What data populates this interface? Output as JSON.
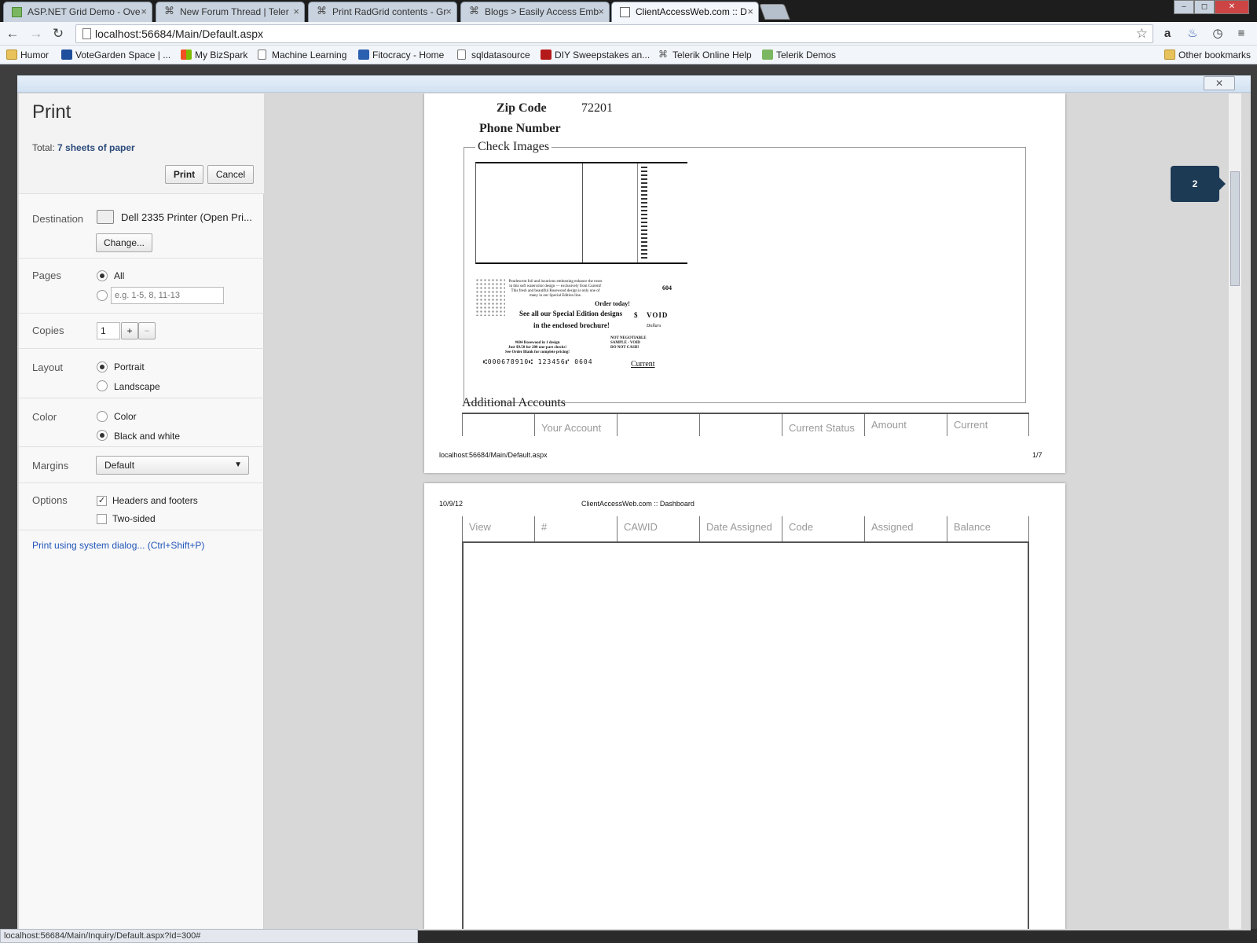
{
  "tabs": [
    {
      "title": "ASP.NET Grid Demo - Ove",
      "icon": "grid-demo-icon"
    },
    {
      "title": "New Forum Thread | Teler",
      "icon": "telerik-icon"
    },
    {
      "title": "Print RadGrid contents - Gr",
      "icon": "telerik-icon"
    },
    {
      "title": "Blogs > Easily Access Emb",
      "icon": "telerik-icon"
    },
    {
      "title": "ClientAccessWeb.com :: D",
      "icon": "page-icon"
    }
  ],
  "window_controls": {
    "minimize": "‒",
    "maximize": "◻",
    "close": "✕"
  },
  "toolbar": {
    "back_icon": "←",
    "forward_icon": "→",
    "reload_icon": "↻",
    "url": "localhost:56684/Main/Default.aspx"
  },
  "bookmarks": [
    {
      "label": "Humor",
      "icon": "folder-icon"
    },
    {
      "label": "VoteGarden Space | ...",
      "icon": "votegarden-icon"
    },
    {
      "label": "My BizSpark",
      "icon": "windows-icon"
    },
    {
      "label": "Machine Learning",
      "icon": "page-icon"
    },
    {
      "label": "Fitocracy - Home",
      "icon": "fitocracy-icon"
    },
    {
      "label": "sqldatasource",
      "icon": "page-icon"
    },
    {
      "label": "DIY Sweepstakes an...",
      "icon": "diy-icon"
    },
    {
      "label": "Telerik Online Help",
      "icon": "telerik-icon"
    },
    {
      "label": "Telerik Demos",
      "icon": "telerik-demos-icon"
    }
  ],
  "other_bookmarks": "Other bookmarks",
  "print": {
    "title": "Print",
    "total_prefix": "Total: ",
    "total_value": "7 sheets of paper",
    "print_button": "Print",
    "cancel_button": "Cancel",
    "destination_label": "Destination",
    "destination_value": "Dell 2335 Printer (Open Pri...",
    "change_button": "Change...",
    "pages_label": "Pages",
    "pages_all": "All",
    "pages_placeholder": "e.g. 1-5, 8, 11-13",
    "copies_label": "Copies",
    "copies_value": "1",
    "copies_plus": "+",
    "copies_minus": "−",
    "layout_label": "Layout",
    "layout_portrait": "Portrait",
    "layout_landscape": "Landscape",
    "color_label": "Color",
    "color_color": "Color",
    "color_bw": "Black and white",
    "margins_label": "Margins",
    "margins_value": "Default",
    "options_label": "Options",
    "option_headers": "Headers and footers",
    "option_twosided": "Two-sided",
    "system_dialog_link": "Print using system dialog... (Ctrl+Shift+P)"
  },
  "preview": {
    "page1": {
      "zip_label": "Zip Code",
      "zip_value": "72201",
      "phone_label": "Phone Number",
      "check_images_legend": "Check Images",
      "check": {
        "number": "604",
        "promo1": "Pearlescent foil and luxurious embossing enhance the roses in this soft watercolor design — exclusively from Current! This fresh and beautiful Rosewood design is only one of many in our Special Edition line.",
        "order_today": "Order today!",
        "see_all": "See all our Special Edition designs",
        "brochure": "in the enclosed brochure!",
        "dollar": "$",
        "void": "VOID",
        "dollars": "Dollars",
        "not_negotiable": "NOT NEGOTIABLE",
        "sample_void": "SAMPLE - VOID",
        "do_not_cash": "DO NOT CASH!",
        "rosewood": "#604 Rosewood in 1 design",
        "price": "Just $9.50 for 200 one-part checks!",
        "order_blank": "See Order Blank for complete pricing!",
        "micr": "⑆000678910⑆ 123456⑈ 0604",
        "brand": "Current"
      },
      "additional_accounts": "Additional Accounts",
      "table_headers_top": [
        "",
        "Your Account",
        "",
        "",
        "Current Status",
        "Amount",
        "Current"
      ],
      "footer_url": "localhost:56684/Main/Default.aspx",
      "footer_page": "1/7"
    },
    "page2": {
      "header_date": "10/9/12",
      "header_title": "ClientAccessWeb.com :: Dashboard",
      "table_headers": [
        "View",
        "#",
        "CAWID",
        "Date Assigned",
        "Code",
        "Assigned",
        "Balance"
      ]
    },
    "page_indicator": "2"
  },
  "statusbar": "localhost:56684/Main/Inquiry/Default.aspx?Id=300#"
}
